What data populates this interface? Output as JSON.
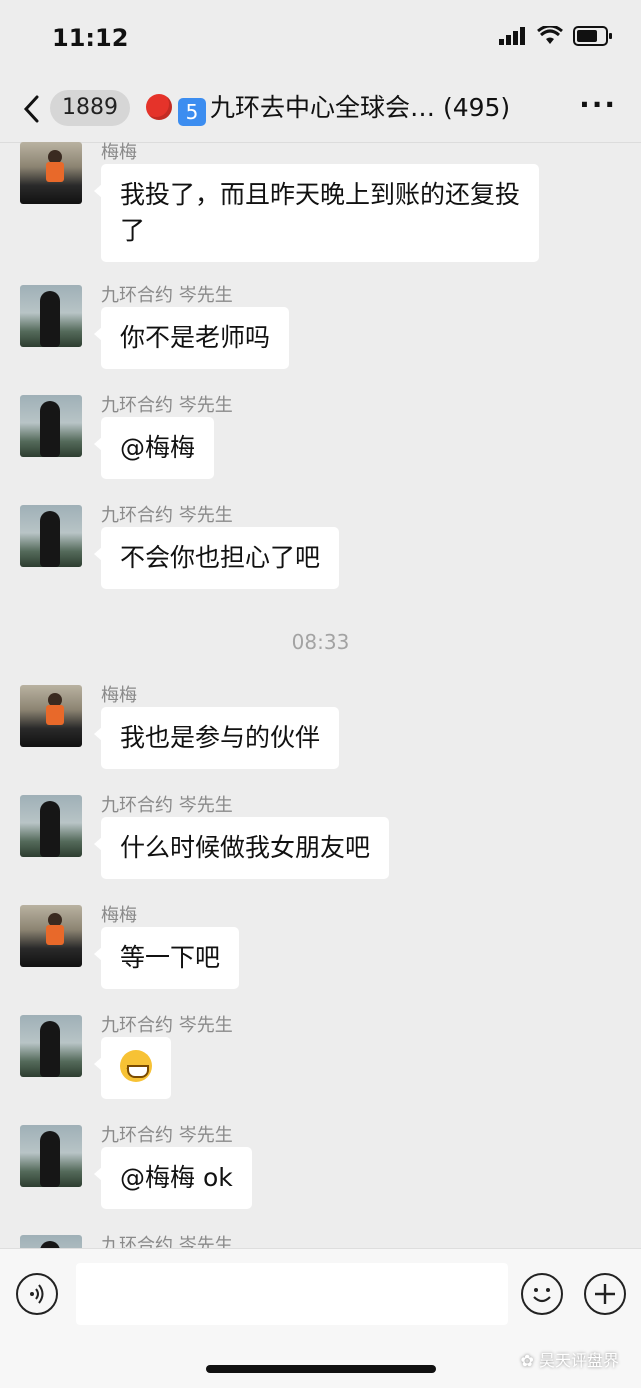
{
  "status": {
    "time": "11:12"
  },
  "nav": {
    "back_icon": "chevron-left",
    "unread_count": "1889",
    "title_num": "5",
    "title": "九环去中心全球会… (495)",
    "more_icon": "ellipsis"
  },
  "messages": [
    {
      "sender": "梅梅",
      "text": "我投了，而且昨天晚上到账的还复投了"
    },
    {
      "sender": "九环合约  岑先生",
      "text": "你不是老师吗"
    },
    {
      "sender": "九环合约  岑先生",
      "text": "@梅梅"
    },
    {
      "sender": "九环合约  岑先生",
      "text": "不会你也担心了吧"
    },
    {
      "sender": "梅梅",
      "text": "我也是参与的伙伴"
    },
    {
      "sender": "九环合约  岑先生",
      "text": "什么时候做我女朋友吧"
    },
    {
      "sender": "梅梅",
      "text": "等一下吧"
    },
    {
      "sender": "九环合约  岑先生",
      "emoji": "grinning-face"
    },
    {
      "sender": "九环合约  岑先生",
      "text": "@梅梅 ok"
    },
    {
      "sender": "九环合约  岑先生"
    }
  ],
  "timestamp": "08:33",
  "input": {
    "voice_icon": "voice",
    "emoji_icon": "smiley",
    "plus_icon": "plus",
    "placeholder": ""
  },
  "watermark": "昊天评盘界"
}
